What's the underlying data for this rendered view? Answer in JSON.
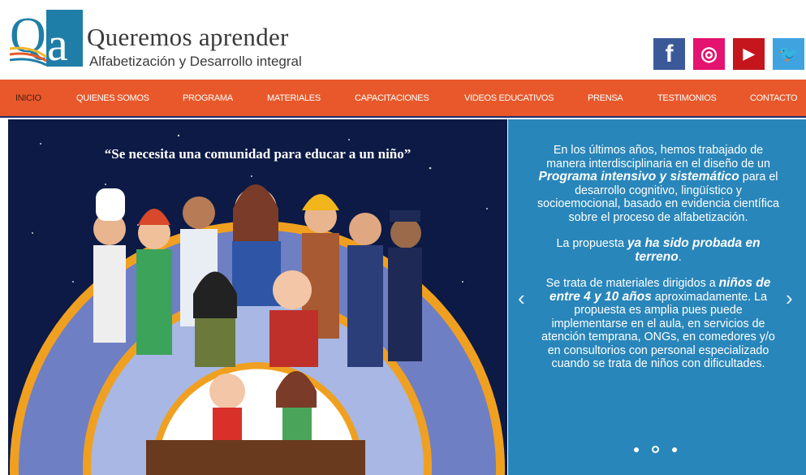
{
  "header": {
    "logo_letters": "Qa",
    "title": "Queremos aprender",
    "subtitle": "Alfabetización y Desarrollo integral"
  },
  "social": [
    {
      "name": "facebook",
      "glyph": "f",
      "color": "#3b5998"
    },
    {
      "name": "instagram",
      "glyph": "◎",
      "color": "#e4136f"
    },
    {
      "name": "youtube",
      "glyph": "▶",
      "color": "#c4161c"
    },
    {
      "name": "twitter",
      "glyph": "🐦",
      "color": "#3fa3e0"
    }
  ],
  "nav": {
    "items": [
      {
        "label": "INICIO",
        "active": true
      },
      {
        "label": "QUIENES SOMOS"
      },
      {
        "label": "PROGRAMA"
      },
      {
        "label": "MATERIALES"
      },
      {
        "label": "CAPACITACIONES"
      },
      {
        "label": "VIDEOS EDUCATIVOS"
      },
      {
        "label": "PRENSA"
      },
      {
        "label": "TESTIMONIOS"
      },
      {
        "label": "CONTACTO"
      }
    ]
  },
  "hero": {
    "quote": "“Se necesita una comunidad para educar a un niño”"
  },
  "slide": {
    "p1a": "En los últimos años, hemos trabajado de manera interdisciplinaria en el diseño de un ",
    "p1b": "Programa intensivo y sistemático",
    "p1c": " para el desarrollo cognitivo, lingüístico y socioemocional, basado en evidencia científica sobre el proceso de alfabetización.",
    "p2a": "La propuesta ",
    "p2b": "ya ha sido probada en terreno",
    "p2c": ".",
    "p3a": "Se trata de materiales dirigidos a ",
    "p3b": "niños de entre 4 y 10 años",
    "p3c": " aproximadamente. La propuesta es amplia pues puede implementarse en el aula, en servicios de atención temprana, ONGs, en comedores y/o en consultorios con personal especializado cuando se trata de niños con dificultades.",
    "prev": "‹",
    "next": "›",
    "current_slide": 2,
    "total_slides": 3
  },
  "colors": {
    "nav": "#e8582a",
    "panel": "#2986ba",
    "logo": "#1f7ea8"
  }
}
